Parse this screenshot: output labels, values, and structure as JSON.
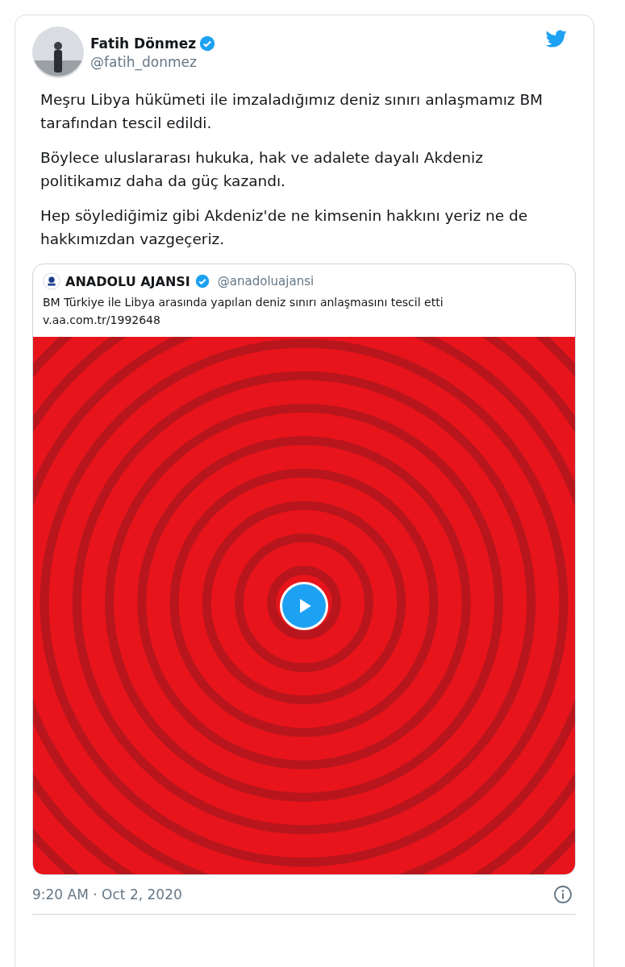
{
  "tweet": {
    "author": {
      "name": "Fatih Dönmez",
      "verified": true,
      "handle": "@fatih_donmez"
    },
    "paragraphs": [
      "Meşru Libya hükümeti ile imzaladığımız deniz sınırı anlaşmamız BM tarafından tescil edildi.",
      "Böylece uluslararası hukuka, hak ve adalete dayalı Akdeniz politikamız daha da güç kazandı.",
      "Hep söylediğimiz gibi Akdeniz'de ne kimsenin hakkını yeriz ne de hakkımızdan vazgeçeriz."
    ],
    "quoted": {
      "name": "ANADOLU AJANSI",
      "verified": true,
      "handle": "@anadoluajansi",
      "text": "BM Türkiye ile Libya arasında yapılan deniz sınırı anlaşmasını tescil etti",
      "link": "v.aa.com.tr/1992648"
    },
    "timestamp": "9:20 AM · Oct 2, 2020"
  }
}
